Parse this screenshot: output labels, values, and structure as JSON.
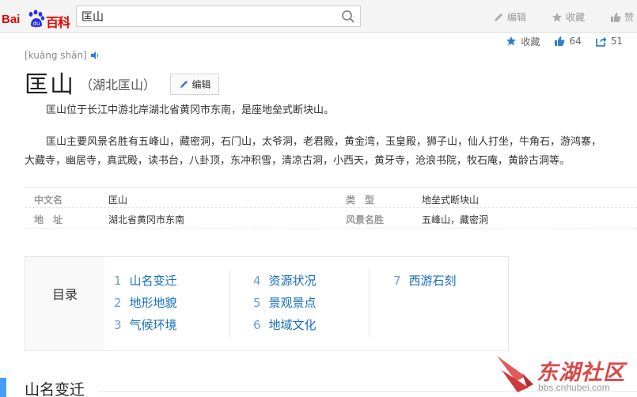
{
  "header": {
    "logo_bai": "Bai",
    "logo_baike": "百科",
    "search_value": "匡山",
    "actions": [
      {
        "label": "编辑",
        "icon": "pencil-icon"
      },
      {
        "label": "收藏",
        "icon": "star-icon"
      },
      {
        "label": "赞",
        "icon": "thumbs-up-icon"
      }
    ]
  },
  "share": {
    "favorite_label": "收藏",
    "like_count": "64",
    "share_count": "51"
  },
  "entry": {
    "pinyin": "[kuāng shān]",
    "title": "匡山",
    "subtitle": "（湖北匡山）",
    "edit_label": "编辑"
  },
  "summary": [
    "匡山位于长江中游北岸湖北省黄冈市东南，是座地垒式断块山。",
    "匡山主要风景名胜有五峰山，藏密洞，石门山，太爷洞，老君殿，黄金湾，玉皇殿，狮子山，仙人打坐，牛角石，游鸿寨，",
    "大藏寺，幽居寺，真武殿，读书台，八卦顶，东冲积雪，清凉古洞，小西天，黄牙寺，沧浪书院，牧石庵，黄龄古洞等。"
  ],
  "info": {
    "row1": {
      "k1": "中文名",
      "v1": "匡山",
      "k2": "类　型",
      "v2": "地垒式断块山"
    },
    "row2": {
      "k1": "地　址",
      "v1": "湖北省黄冈市东南",
      "k2": "风景名胜",
      "v2": "五峰山，藏密洞"
    }
  },
  "catalog": {
    "label": "目录",
    "items": [
      {
        "num": "1",
        "text": "山名变迁"
      },
      {
        "num": "2",
        "text": "地形地貌"
      },
      {
        "num": "3",
        "text": "气候环境"
      },
      {
        "num": "4",
        "text": "资源状况"
      },
      {
        "num": "5",
        "text": "景观景点"
      },
      {
        "num": "6",
        "text": "地域文化"
      },
      {
        "num": "7",
        "text": "西游石刻"
      }
    ]
  },
  "section_title": "山名变迁",
  "watermark": {
    "text": "东湖社区",
    "url": "bbs.cnhubei.com"
  },
  "colors": {
    "brand_red": "#e10601",
    "link_blue": "#136ec2",
    "accent_blue": "#459df5"
  }
}
